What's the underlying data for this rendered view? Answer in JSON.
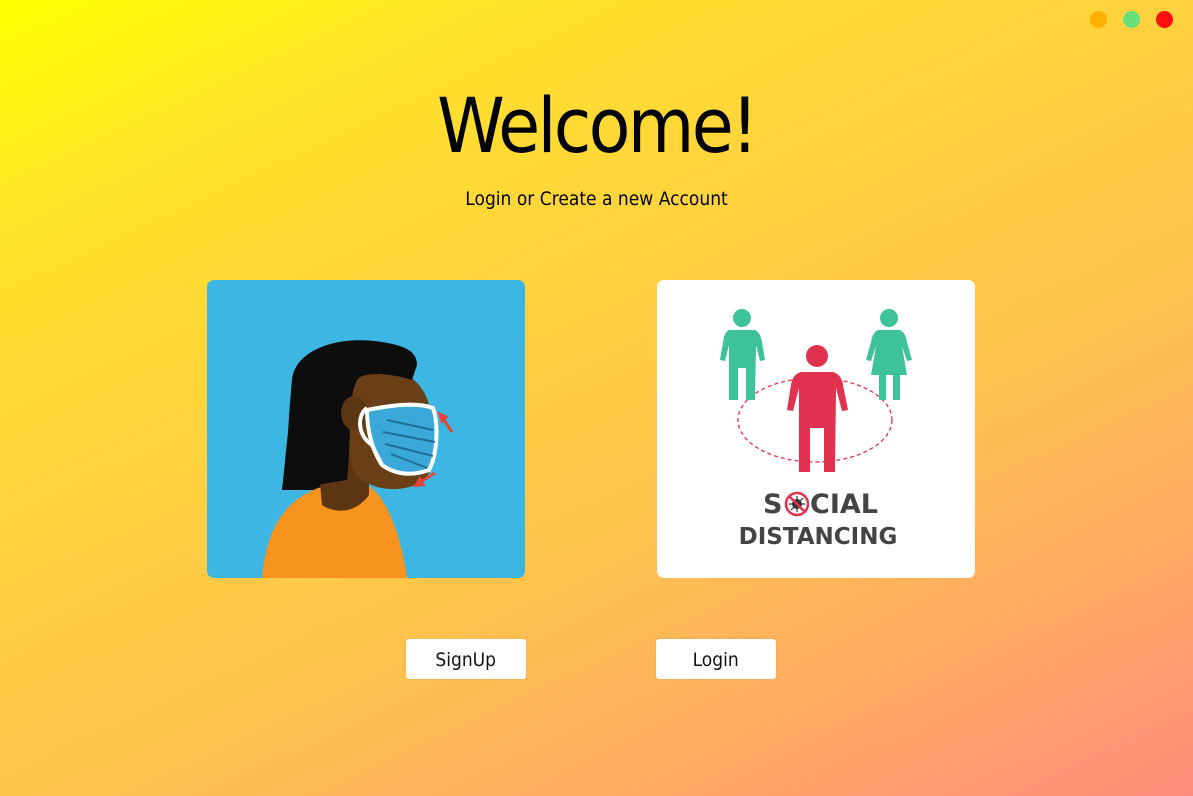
{
  "window": {
    "controls": [
      {
        "name": "minimize",
        "color": "#ffb000"
      },
      {
        "name": "maximize",
        "color": "#66e07a"
      },
      {
        "name": "close",
        "color": "#ff1010"
      }
    ]
  },
  "header": {
    "title": "Welcome!",
    "subtitle": "Login or Create a new Account"
  },
  "cards": {
    "mask": {
      "illustration": "woman-wearing-face-mask",
      "bg_color": "#3db6e3"
    },
    "distancing": {
      "illustration": "social-distancing-people",
      "text_line1_before": "S",
      "text_line1_after": "CIAL",
      "text_line2": "DISTANCING"
    }
  },
  "buttons": {
    "signup_label": "SignUp",
    "login_label": "Login"
  }
}
